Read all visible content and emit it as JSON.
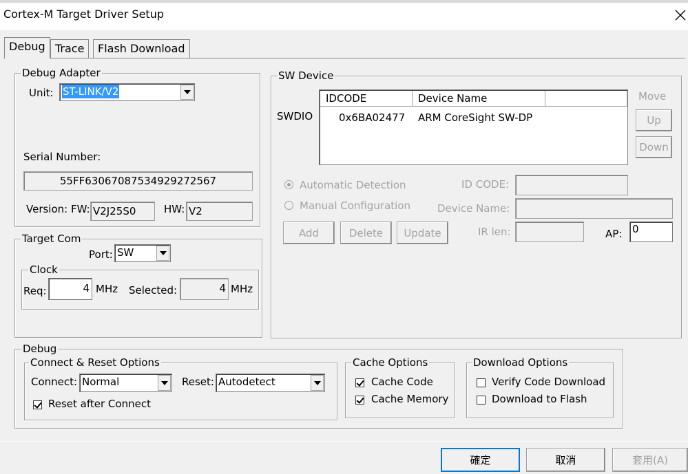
{
  "window": {
    "title": "Cortex-M Target Driver Setup"
  },
  "tabs": [
    {
      "label": "Debug"
    },
    {
      "label": "Trace"
    },
    {
      "label": "Flash Download"
    }
  ],
  "debug_adapter": {
    "legend": "Debug Adapter",
    "unit_label": "Unit:",
    "unit_value": "ST-LINK/V2",
    "serial_label": "Serial Number:",
    "serial_value": "55FF63067087534929272567",
    "version_label": "Version: FW:",
    "fw_value": "V2J25S0",
    "hw_label": "HW:",
    "hw_value": "V2"
  },
  "target_com": {
    "legend": "Target Com",
    "port_label": "Port:",
    "port_value": "SW",
    "clock_legend": "Clock",
    "req_label": "Req:",
    "req_value": "4",
    "req_unit": "MHz",
    "selected_label": "Selected:",
    "selected_value": "4",
    "selected_unit": "MHz"
  },
  "sw_device": {
    "legend": "SW Device",
    "row_label": "SWDIO",
    "columns": [
      "IDCODE",
      "Device Name"
    ],
    "rows": [
      {
        "idcode": "0x6BA02477",
        "device_name": "ARM CoreSight SW-DP"
      }
    ],
    "move_label": "Move",
    "up_label": "Up",
    "down_label": "Down",
    "auto_detect_label": "Automatic Detection",
    "manual_config_label": "Manual Configuration",
    "idcode_label": "ID CODE:",
    "device_name_label": "Device Name:",
    "irlen_label": "IR len:",
    "ap_label": "AP:",
    "ap_value": "0",
    "add_label": "Add",
    "delete_label": "Delete",
    "update_label": "Update"
  },
  "debug_group": {
    "legend": "Debug",
    "connect_reset": {
      "legend": "Connect & Reset Options",
      "connect_label": "Connect:",
      "connect_value": "Normal",
      "reset_label": "Reset:",
      "reset_value": "Autodetect",
      "reset_after_connect_label": "Reset after Connect",
      "reset_after_connect_checked": true
    },
    "cache": {
      "legend": "Cache Options",
      "cache_code_label": "Cache Code",
      "cache_code_checked": true,
      "cache_memory_label": "Cache Memory",
      "cache_memory_checked": true
    },
    "download": {
      "legend": "Download Options",
      "verify_label": "Verify Code Download",
      "verify_checked": false,
      "flash_label": "Download to Flash",
      "flash_checked": false
    }
  },
  "footer": {
    "ok_label": "確定",
    "cancel_label": "取消",
    "apply_label": "套用(A)"
  }
}
